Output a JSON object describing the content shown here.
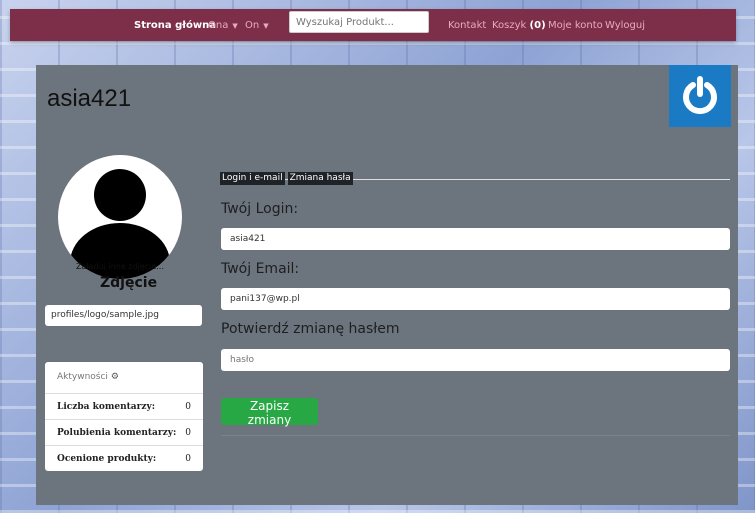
{
  "navbar": {
    "brand": "Strona główna",
    "dropdown_ona": "Ona",
    "dropdown_on": "On",
    "search_placeholder": "Wyszukaj Produkt...",
    "contact": "Kontakt",
    "cart_label": "Koszyk",
    "cart_count": "(0)",
    "account": "Moje konto",
    "logout": "Wyloguj"
  },
  "profile": {
    "username": "asia421",
    "upload_link": "Załaduj inne zdjęcie...",
    "photo_title": "Zdjęcie",
    "photo_path": "profiles/logo/sample.jpg"
  },
  "activity": {
    "title": "Aktywności",
    "rows": [
      {
        "label": "Liczba komentarzy:",
        "value": "0"
      },
      {
        "label": "Polubienia komentarzy:",
        "value": "0"
      },
      {
        "label": "Ocenione produkty:",
        "value": "0"
      }
    ]
  },
  "tabs": [
    "Login i e-mail",
    "Zmiana hasła"
  ],
  "form": {
    "login_label": "Twój Login:",
    "login_value": "asia421",
    "email_label": "Twój Email:",
    "email_value": "pani137@wp.pl",
    "confirm_label": "Potwierdź zmianę hasłem",
    "password_placeholder": "hasło",
    "save_label": "Zapisz zmiany"
  },
  "colors": {
    "navbar": "#7d2f4a",
    "panel": "#6c757d",
    "power_button": "#1a7bc4",
    "save_button": "#28a745"
  }
}
